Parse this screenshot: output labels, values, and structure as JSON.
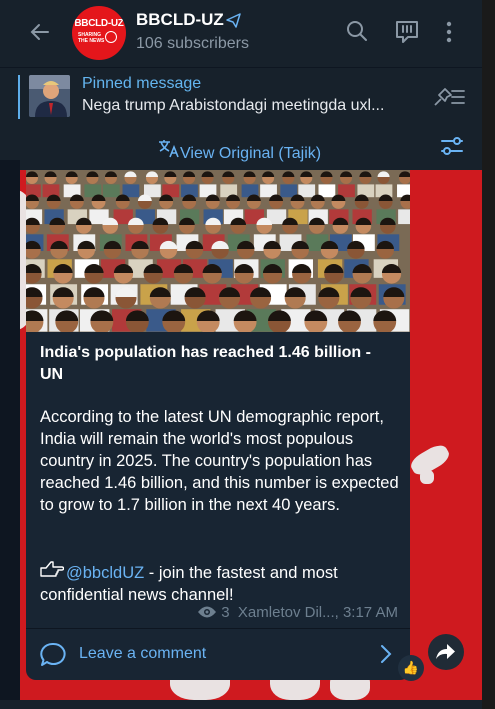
{
  "header": {
    "channel_name": "BBCLD-UZ",
    "subscribers": "106 subscribers",
    "avatar_logo_text": "BBCLD-UZ",
    "avatar_tagline": "SHARING THE NEWS"
  },
  "pinned": {
    "title": "Pinned message",
    "text": "Nega trump Arabistondagi meetingda uxl..."
  },
  "translate": {
    "label": "View Original (Tajik)"
  },
  "post": {
    "headline": "India's population has reached 1.46 billion - UN",
    "body": "According to the latest UN demographic report, India will remain the world's most populous country in 2025. The country's population has reached 1.46 billion, and this number is expected to grow to 1.7 billion in the next 40 years.",
    "promo_link": "@bbcldUZ",
    "promo_text": " - join the fastest and most confidential news channel!",
    "views": "3",
    "author_time": "Xamletov Dil..., 3:17 AM",
    "comment_label": "Leave a comment",
    "reaction": "👍"
  },
  "colors": {
    "accent": "#6ab3f3",
    "background": "#17212b",
    "card": "#182533",
    "brand_red": "#cf1a1f"
  },
  "icons": [
    "back-arrow-icon",
    "verified-icon",
    "search-icon",
    "comments-icon",
    "more-icon",
    "unpin-icon",
    "translate-icon",
    "filter-icon",
    "eye-icon",
    "comment-icon",
    "chevron-right-icon",
    "share-icon",
    "thumbs-up-icon",
    "pointing-hand-icon"
  ]
}
